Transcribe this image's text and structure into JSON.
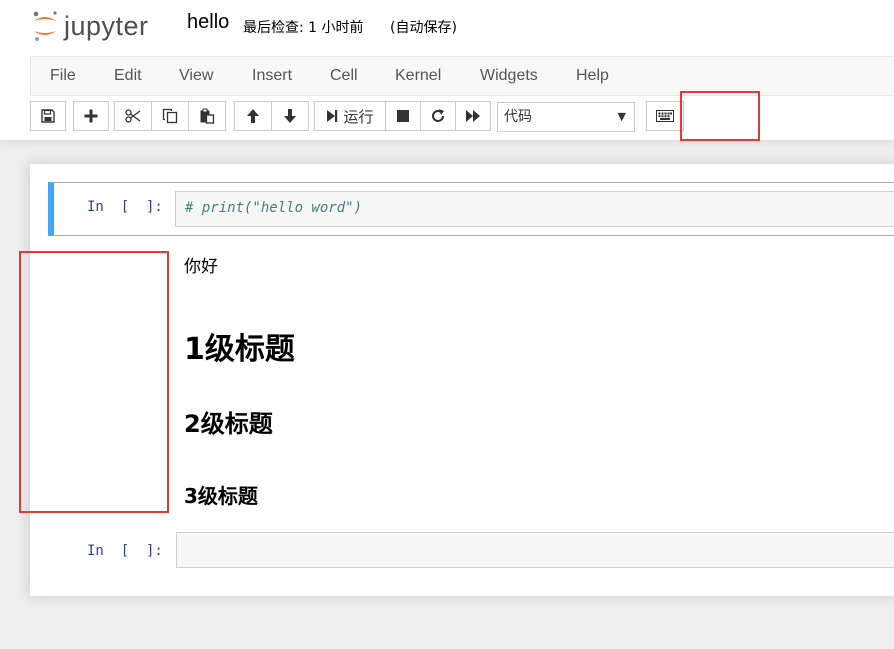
{
  "header": {
    "logo_text": "jupyter",
    "notebook_name": "hello",
    "checkpoint": "最后检查: 1 小时前",
    "autosave": "(自动保存)"
  },
  "menu": [
    {
      "label": "File"
    },
    {
      "label": "Edit"
    },
    {
      "label": "View"
    },
    {
      "label": "Insert"
    },
    {
      "label": "Cell"
    },
    {
      "label": "Kernel"
    },
    {
      "label": "Widgets"
    },
    {
      "label": "Help"
    }
  ],
  "toolbar": {
    "run_label": "运行",
    "cell_type": "代码",
    "icons": [
      "save-icon",
      "plus-icon",
      "cut-icon",
      "copy-icon",
      "paste-icon",
      "arrow-up-icon",
      "arrow-down-icon",
      "step-forward-icon",
      "stop-icon",
      "refresh-icon",
      "fast-forward-icon",
      "keyboard-icon"
    ]
  },
  "cells": {
    "code1": {
      "prompt": "In  [  ]:",
      "code": "# print(\"hello word\")"
    },
    "markdown": {
      "p": "你好",
      "h1": "1级标题",
      "h2": "2级标题",
      "h3": "3级标题"
    },
    "code2": {
      "prompt": "In  [  ]:",
      "code": ""
    }
  },
  "colors": {
    "accent_selected": "#42a5f5",
    "prompt_blue": "#303f9f",
    "comment_teal": "#408080",
    "logo_orange": "#f37726",
    "highlight_red": "#e53935"
  }
}
